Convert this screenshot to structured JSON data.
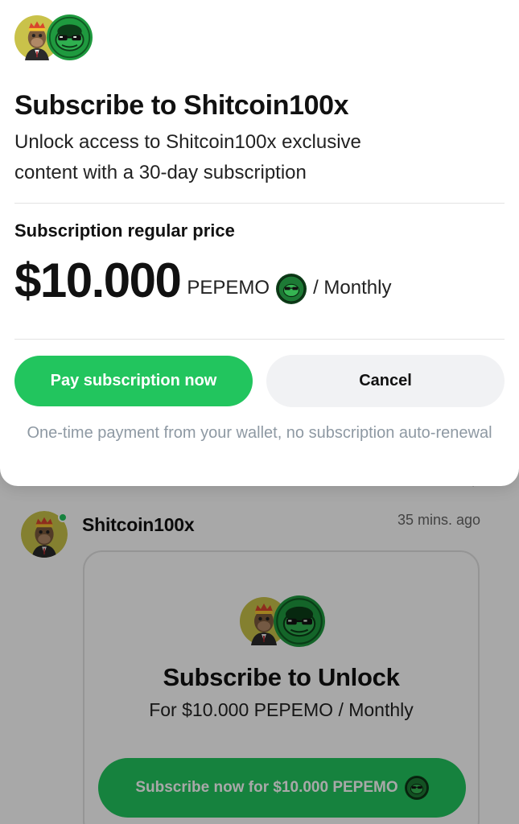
{
  "modal": {
    "title": "Subscribe to Shitcoin100x",
    "description": "Unlock access to Shitcoin100x exclusive content with a 30-day subscription",
    "price_label": "Subscription regular price",
    "price_amount": "$10.000",
    "price_token": "PEPEMO",
    "price_period": "/ Monthly",
    "pay_button_label": "Pay subscription now",
    "cancel_button_label": "Cancel",
    "note": "One-time payment from your wallet, no subscription auto-renewal"
  },
  "post": {
    "author": "Shitcoin100x",
    "time": "35 mins. ago",
    "online": true,
    "card": {
      "title": "Subscribe to Unlock",
      "subtitle": "For $10.000 PEPEMO / Monthly",
      "button_label": "Subscribe now for $10.000 PEPEMO"
    }
  },
  "icons": {
    "creator_avatar": "ape-avatar-icon",
    "token_avatar": "pepemo-coin-icon",
    "reply": "reply-arrow-icon"
  },
  "colors": {
    "accent_green": "#22c55e",
    "cancel_bg": "#f1f2f4",
    "note_text": "#8e99a3"
  }
}
